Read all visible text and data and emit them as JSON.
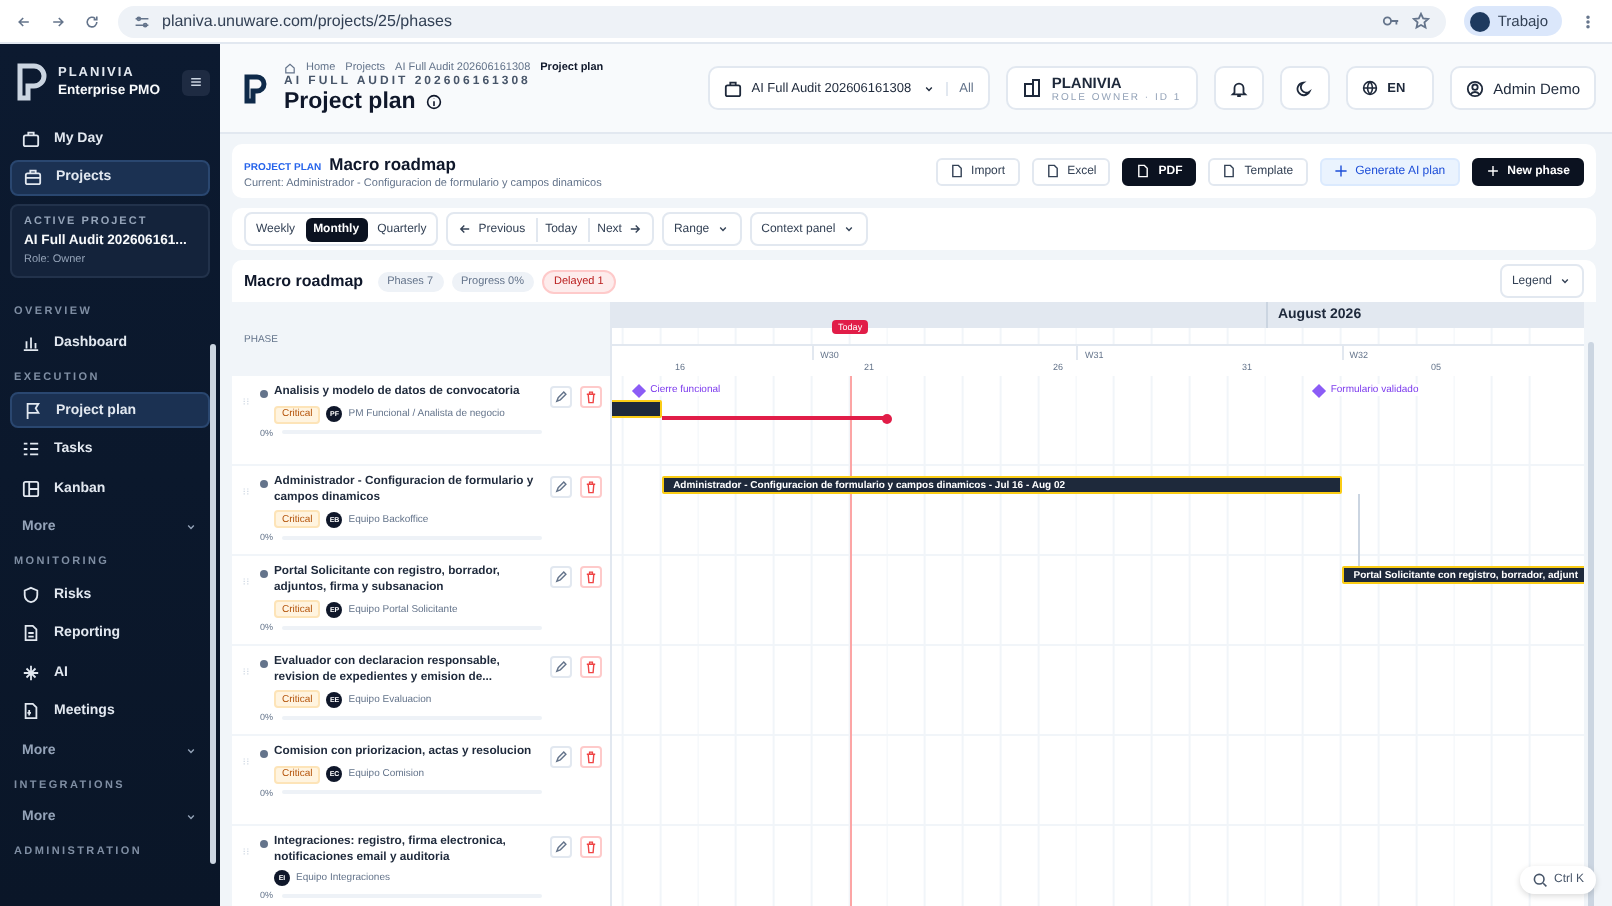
{
  "browser": {
    "url": "planiva.unuware.com/projects/25/phases",
    "profile": "Trabajo"
  },
  "sidebar": {
    "brand": "PLANIVIA",
    "subtitle": "Enterprise PMO",
    "top_items": [
      {
        "label": "My Day",
        "selected": false
      },
      {
        "label": "Projects",
        "selected": true
      }
    ],
    "active_project": {
      "heading": "ACTIVE PROJECT",
      "name": "AI Full Audit 202606161...",
      "role": "Role: Owner"
    },
    "sections": [
      {
        "title": "OVERVIEW",
        "items": [
          {
            "label": "Dashboard",
            "kind": "link",
            "selected": false
          }
        ]
      },
      {
        "title": "EXECUTION",
        "items": [
          {
            "label": "Project plan",
            "kind": "link",
            "selected": true
          },
          {
            "label": "Tasks",
            "kind": "link",
            "selected": false
          },
          {
            "label": "Kanban",
            "kind": "link",
            "selected": false
          },
          {
            "label": "More",
            "kind": "more",
            "selected": false
          }
        ]
      },
      {
        "title": "MONITORING",
        "items": [
          {
            "label": "Risks",
            "kind": "link",
            "selected": false
          },
          {
            "label": "Reporting",
            "kind": "link",
            "selected": false
          },
          {
            "label": "AI",
            "kind": "link",
            "selected": false
          },
          {
            "label": "Meetings",
            "kind": "link",
            "selected": false
          },
          {
            "label": "More",
            "kind": "more",
            "selected": false
          }
        ]
      },
      {
        "title": "INTEGRATIONS",
        "items": [
          {
            "label": "More",
            "kind": "more",
            "selected": false
          }
        ]
      },
      {
        "title": "ADMINISTRATION"
      }
    ]
  },
  "header": {
    "breadcrumb": [
      "Home",
      "Projects",
      "AI Full Audit 202606161308",
      "Project plan"
    ],
    "project_code": "AI FULL AUDIT 202606161308",
    "title": "Project plan",
    "project_select": "AI Full Audit 202606161308",
    "scope": "All",
    "org": "PLANIVIA",
    "role": "ROLE OWNER · ID 1",
    "language": "EN",
    "user": "Admin Demo"
  },
  "plan_card": {
    "eyebrow": "PROJECT PLAN",
    "title": "Macro roadmap",
    "current": "Current: Administrador - Configuracion de formulario y campos dinamicos",
    "actions": [
      {
        "label": "Import",
        "kind": "plain"
      },
      {
        "label": "Excel",
        "kind": "plain"
      },
      {
        "label": "PDF",
        "kind": "dark"
      },
      {
        "label": "Template",
        "kind": "plain"
      },
      {
        "label": "Generate AI plan",
        "kind": "ai"
      },
      {
        "label": "New phase",
        "kind": "primary"
      }
    ]
  },
  "toolbar": {
    "views": [
      {
        "label": "Weekly",
        "selected": false
      },
      {
        "label": "Monthly",
        "selected": true
      },
      {
        "label": "Quarterly",
        "selected": false
      }
    ],
    "nav": [
      "Previous",
      "Today",
      "Next"
    ],
    "range": "Range",
    "context": "Context panel"
  },
  "gantt": {
    "title": "Macro roadmap",
    "chips": [
      {
        "label": "Phases 7",
        "kind": "neutral"
      },
      {
        "label": "Progress 0%",
        "kind": "neutral"
      },
      {
        "label": "Delayed 1",
        "kind": "danger"
      }
    ],
    "legend": "Legend",
    "phase_header": "PHASE",
    "today_label": "Today",
    "months": [
      "August 2026"
    ],
    "weeks": [
      "W30",
      "W31",
      "W32"
    ],
    "days": [
      "16",
      "21",
      "26",
      "31",
      "05"
    ],
    "milestones": [
      "Cierre funcional",
      "Formulario validado"
    ],
    "phases": [
      {
        "title": "Analisis y modelo de datos de convocatoria",
        "tag": "Critical",
        "initials": "PF",
        "owner": "PM Funcional / Analista de negocio",
        "progress": "0%",
        "level": 0,
        "bar": {
          "delayed": true
        }
      },
      {
        "title": "Administrador - Configuracion de formulario y campos dinamicos",
        "tag": "Critical",
        "initials": "EB",
        "owner": "Equipo Backoffice",
        "progress": "0%",
        "level": 0,
        "bar": {
          "label": "Administrador - Configuracion de formulario y campos dinamicos - Jul 16 - Aug 02"
        }
      },
      {
        "title": "Portal Solicitante con registro, borrador, adjuntos, firma y subsanacion",
        "tag": "Critical",
        "initials": "EP",
        "owner": "Equipo Portal Solicitante",
        "progress": "0%",
        "level": 0,
        "bar": {
          "label": "Portal Solicitante con registro, borrador, adjunt"
        }
      },
      {
        "title": "Evaluador con declaracion responsable, revision de expedientes y emision de...",
        "tag": "Critical",
        "initials": "EE",
        "owner": "Equipo Evaluacion",
        "progress": "0%",
        "level": 0
      },
      {
        "title": "Comision con priorizacion, actas y resolucion",
        "tag": "Critical",
        "initials": "EC",
        "owner": "Equipo Comision",
        "progress": "0%",
        "level": 0
      },
      {
        "title": "Integraciones: registro, firma electronica, notificaciones email y auditoria",
        "initials": "EI",
        "owner": "Equipo Integraciones",
        "progress": "0%",
        "level": 0
      }
    ]
  },
  "search_hint": "Ctrl K"
}
